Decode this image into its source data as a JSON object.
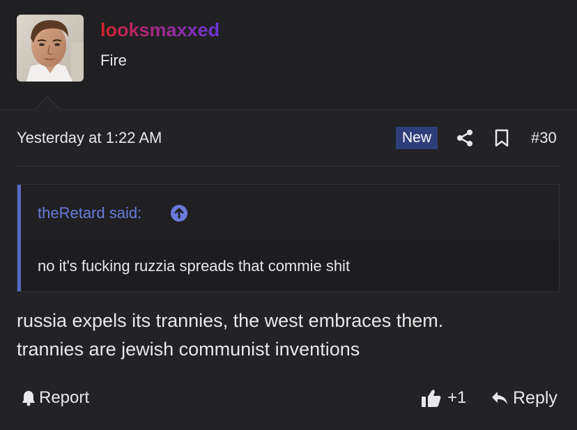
{
  "user": {
    "name": "looksmaxxed",
    "title": "Fire",
    "avatar_icon": "user-avatar-photo",
    "name_gradient": [
      "#d4222e",
      "#a02a8c",
      "#6a35d8"
    ]
  },
  "meta": {
    "date": "Yesterday at 1:22 AM",
    "new_badge": "New",
    "post_number": "#30",
    "share_icon": "share-icon",
    "bookmark_icon": "bookmark-icon"
  },
  "quote": {
    "author": "theRetard said:",
    "jump_icon": "arrow-up-circle-icon",
    "text": "no it's fucking ruzzia spreads that commie shit",
    "accent": "#5a68c8"
  },
  "body": {
    "lines": [
      "russia expels its trannies, the west embraces them.",
      "trannies are jewish communist inventions"
    ]
  },
  "actions": {
    "report": "Report",
    "like_count": "+1",
    "reply": "Reply"
  },
  "colors": {
    "background": "#232325",
    "badge": "#2d3e7a",
    "link": "#6a7bdb"
  }
}
